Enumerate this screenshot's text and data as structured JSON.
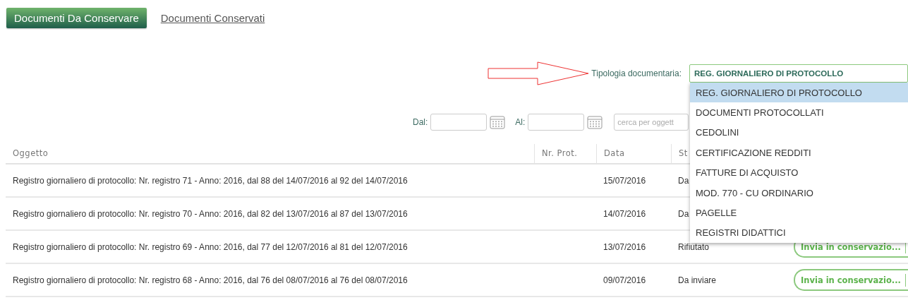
{
  "tabs": [
    {
      "label": "Documenti Da Conservare",
      "selected": true
    },
    {
      "label": "Documenti Conservati",
      "selected": false
    }
  ],
  "type_filter": {
    "label": "Tipologia documentaria:",
    "value": "REG. GIORNALIERO DI PROTOCOLLO",
    "expanded": true,
    "options": [
      {
        "label": "REG. GIORNALIERO DI PROTOCOLLO",
        "selected": true
      },
      {
        "label": "DOCUMENTI PROTOCOLLATI",
        "selected": false
      },
      {
        "label": "CEDOLINI",
        "selected": false
      },
      {
        "label": "CERTIFICAZIONE REDDITI",
        "selected": false
      },
      {
        "label": "FATTURE DI ACQUISTO",
        "selected": false
      },
      {
        "label": "MOD. 770 - CU ORDINARIO",
        "selected": false
      },
      {
        "label": "PAGELLE",
        "selected": false
      },
      {
        "label": "REGISTRI DIDATTICI",
        "selected": false
      }
    ]
  },
  "date_filter": {
    "from_label": "Dal:",
    "to_label": "Al:",
    "search_placeholder": "cerca per oggett"
  },
  "table": {
    "columns": [
      "Oggetto",
      "Nr. Prot.",
      "Data",
      "St"
    ],
    "rows": [
      {
        "oggetto": "Registro giornaliero di protocollo: Nr. registro 71 - Anno: 2016, dal 88 del 14/07/2016 al 92 del 14/07/2016",
        "data": "15/07/2016",
        "stato": "Da"
      },
      {
        "oggetto": "Registro giornaliero di protocollo: Nr. registro 70 - Anno: 2016, dal 82 del 13/07/2016 al 87 del 13/07/2016",
        "data": "14/07/2016",
        "stato": "Da"
      },
      {
        "oggetto": "Registro giornaliero di protocollo: Nr. registro 69 - Anno: 2016, dal 77 del 12/07/2016 al 81 del 12/07/2016",
        "data": "13/07/2016",
        "stato": "Rifiutato",
        "action": "Invia in conservazio..."
      },
      {
        "oggetto": "Registro giornaliero di protocollo: Nr. registro 68 - Anno: 2016, dal 76 del 08/07/2016 al 76 del 08/07/2016",
        "data": "09/07/2016",
        "stato": "Da inviare",
        "action": "Invia in conservazio..."
      }
    ]
  }
}
